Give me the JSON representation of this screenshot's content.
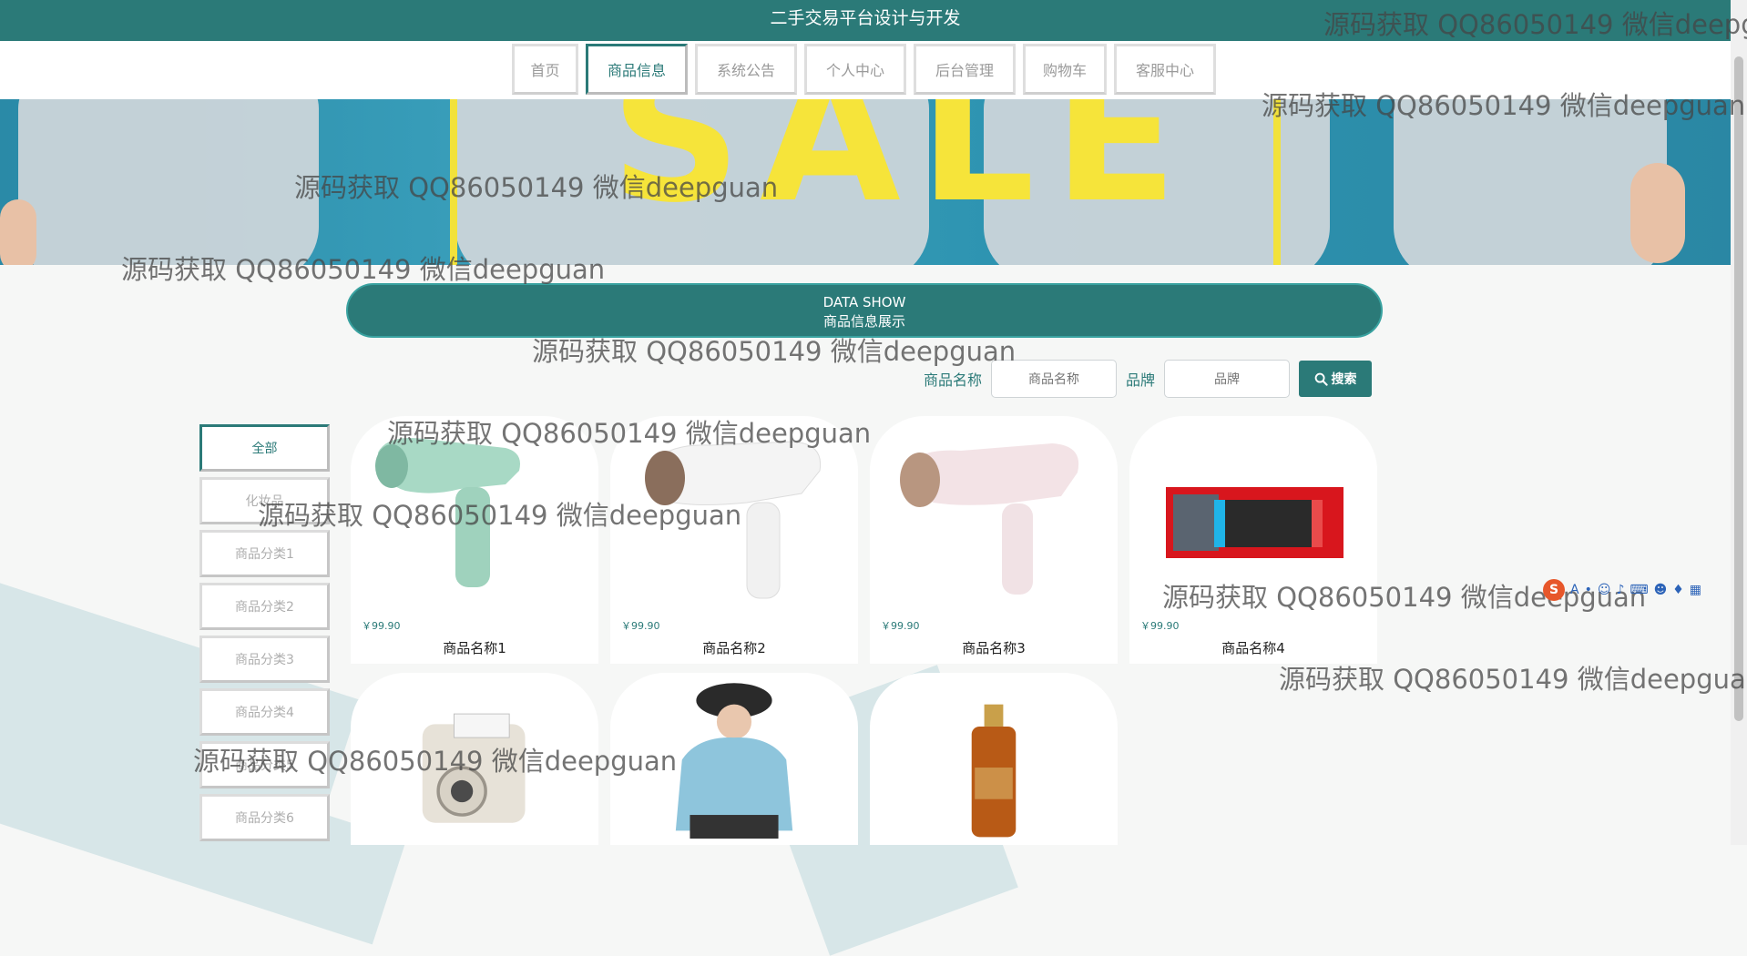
{
  "header": {
    "title": "二手交易平台设计与开发"
  },
  "nav": {
    "items": [
      "首页",
      "商品信息",
      "系统公告",
      "个人中心",
      "后台管理",
      "购物车",
      "客服中心"
    ],
    "active_index": 1
  },
  "banner": {
    "text": "SALE"
  },
  "section": {
    "title_en": "DATA SHOW",
    "title_cn": "商品信息展示"
  },
  "search": {
    "name_label": "商品名称",
    "name_placeholder": "商品名称",
    "brand_label": "品牌",
    "brand_placeholder": "品牌",
    "button_label": "搜索"
  },
  "categories": [
    "全部",
    "化妆品",
    "商品分类1",
    "商品分类2",
    "商品分类3",
    "商品分类4",
    "商品分类5",
    "商品分类6"
  ],
  "products": [
    {
      "name": "商品名称1",
      "price": "￥99.90"
    },
    {
      "name": "商品名称2",
      "price": "￥99.90"
    },
    {
      "name": "商品名称3",
      "price": "￥99.90"
    },
    {
      "name": "商品名称4",
      "price": "￥99.90"
    },
    {
      "name": "",
      "price": ""
    },
    {
      "name": "",
      "price": ""
    },
    {
      "name": "",
      "price": ""
    }
  ],
  "watermark": "源码获取 QQ86050149 微信deepguan",
  "colors": {
    "primary": "#2b7a78",
    "banner_yellow": "#f6e43a"
  }
}
